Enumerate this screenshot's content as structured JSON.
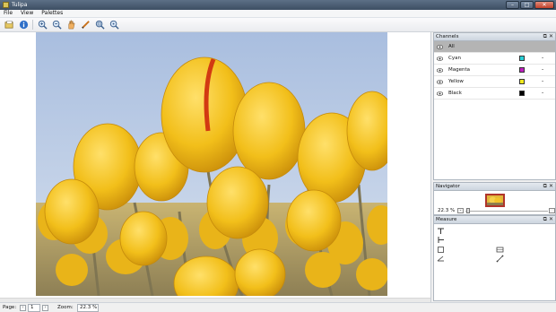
{
  "app": {
    "title": "Tulipa",
    "icon": "app-icon"
  },
  "window_controls": {
    "minimize": "–",
    "maximize": "□",
    "close": "✕"
  },
  "menu": [
    {
      "label": "File"
    },
    {
      "label": "View"
    },
    {
      "label": "Palettes"
    }
  ],
  "toolbar": {
    "tools": [
      {
        "name": "open-icon"
      },
      {
        "name": "info-icon"
      },
      {
        "name": "zoom-in-icon"
      },
      {
        "name": "zoom-out-icon"
      },
      {
        "name": "pan-hand-icon"
      },
      {
        "name": "measure-pencil-icon"
      },
      {
        "name": "zoom-fit-icon"
      },
      {
        "name": "zoom-actual-icon"
      }
    ]
  },
  "panels": {
    "channels": {
      "title": "Channels",
      "items": [
        {
          "label": "All",
          "swatch": "",
          "selected": true,
          "minus": ""
        },
        {
          "label": "Cyan",
          "swatch": "#2ad1d8",
          "selected": false,
          "minus": "-"
        },
        {
          "label": "Magenta",
          "swatch": "#c020c0",
          "selected": false,
          "minus": "-"
        },
        {
          "label": "Yellow",
          "swatch": "#f2ea1c",
          "selected": false,
          "minus": "-"
        },
        {
          "label": "Black",
          "swatch": "#000000",
          "selected": false,
          "minus": "-"
        }
      ]
    },
    "navigator": {
      "title": "Navigator",
      "zoom": "22.3 %"
    },
    "measure": {
      "title": "Measure",
      "tools": [
        {
          "name": "measure-horizontal-icon"
        },
        {
          "name": "measure-vertical-icon"
        },
        {
          "name": "measure-rect-icon"
        },
        {
          "name": "measure-area-icon"
        },
        {
          "name": "measure-angle-icon"
        },
        {
          "name": "measure-line-icon"
        }
      ]
    }
  },
  "panel_buttons": {
    "float": "⧉",
    "close": "✕"
  },
  "statusbar": {
    "page_label": "Page:",
    "page_value": "1",
    "zoom_label": "Zoom:",
    "zoom_value": "22.3 %"
  },
  "colors": {
    "selection_bar": "#b4b4b4",
    "sky": "#b9cbe4",
    "tulip": "#f1c21c",
    "stem": "#857a55"
  }
}
